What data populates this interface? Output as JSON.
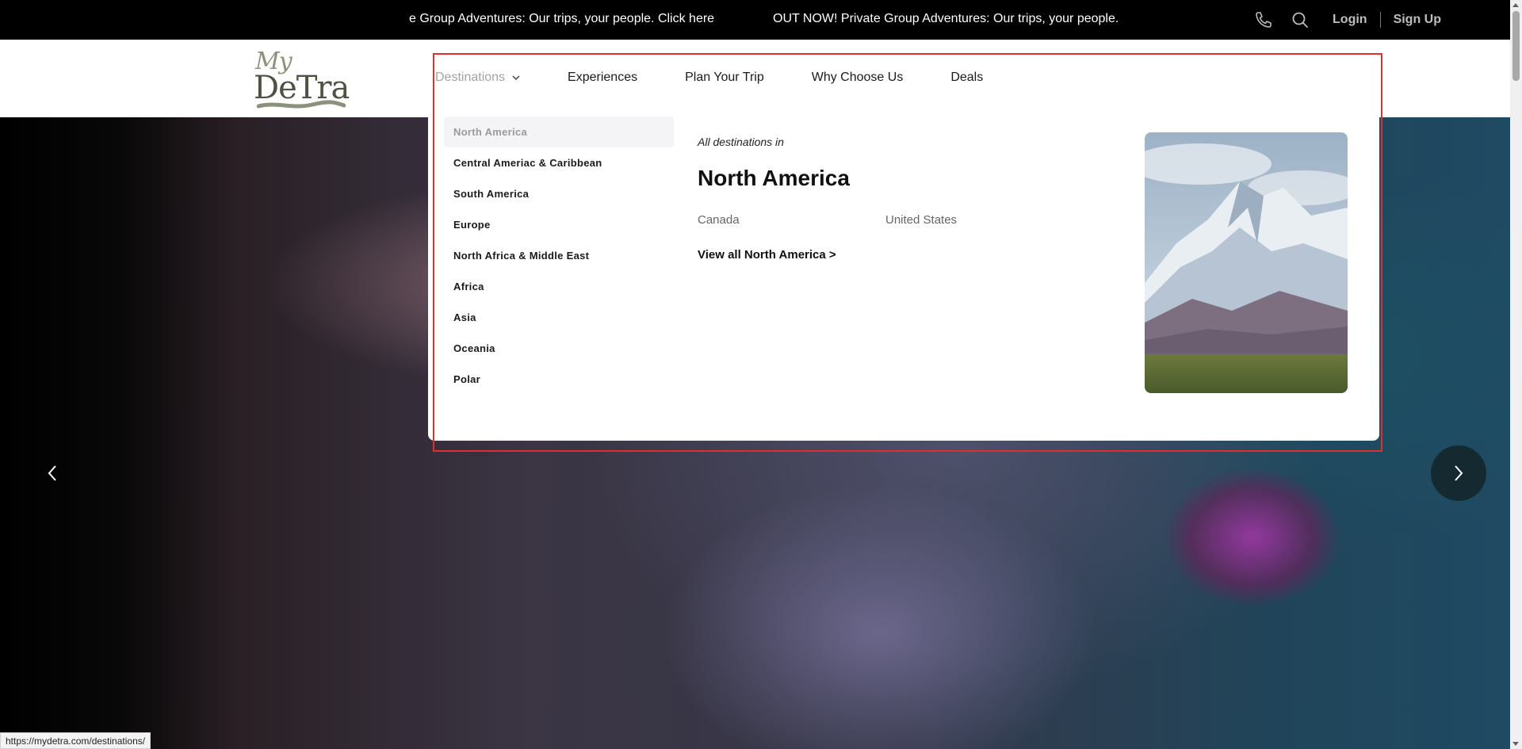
{
  "announcement": {
    "segment_1": "e Group Adventures: Our trips, your people. Click here",
    "segment_2": "OUT NOW! Private Group Adventures: Our trips, your people."
  },
  "top_actions": {
    "phone_icon": "phone-icon",
    "search_icon": "search-icon",
    "login_label": "Login",
    "signup_label": "Sign Up"
  },
  "logo": {
    "top": "My",
    "main": "DeTra"
  },
  "nav": {
    "items": [
      "Destinations",
      "Experiences",
      "Plan Your Trip",
      "Why Choose Us",
      "Deals"
    ],
    "active": "Destinations"
  },
  "mega_menu": {
    "regions": [
      "North America",
      "Central Ameriac & Caribbean",
      "South America",
      "Europe",
      "North Africa & Middle East",
      "Africa",
      "Asia",
      "Oceania",
      "Polar"
    ],
    "selected_region": "North America",
    "subtitle": "All destinations in",
    "title": "North America",
    "countries": [
      "Canada",
      "United States"
    ],
    "view_all": "View all North America >"
  },
  "colors": {
    "outline": "#e12d2d",
    "logo_green": "#8b927b",
    "arrow_button": "#142a30"
  },
  "status_bar": {
    "url": "https://mydetra.com/destinations/"
  }
}
